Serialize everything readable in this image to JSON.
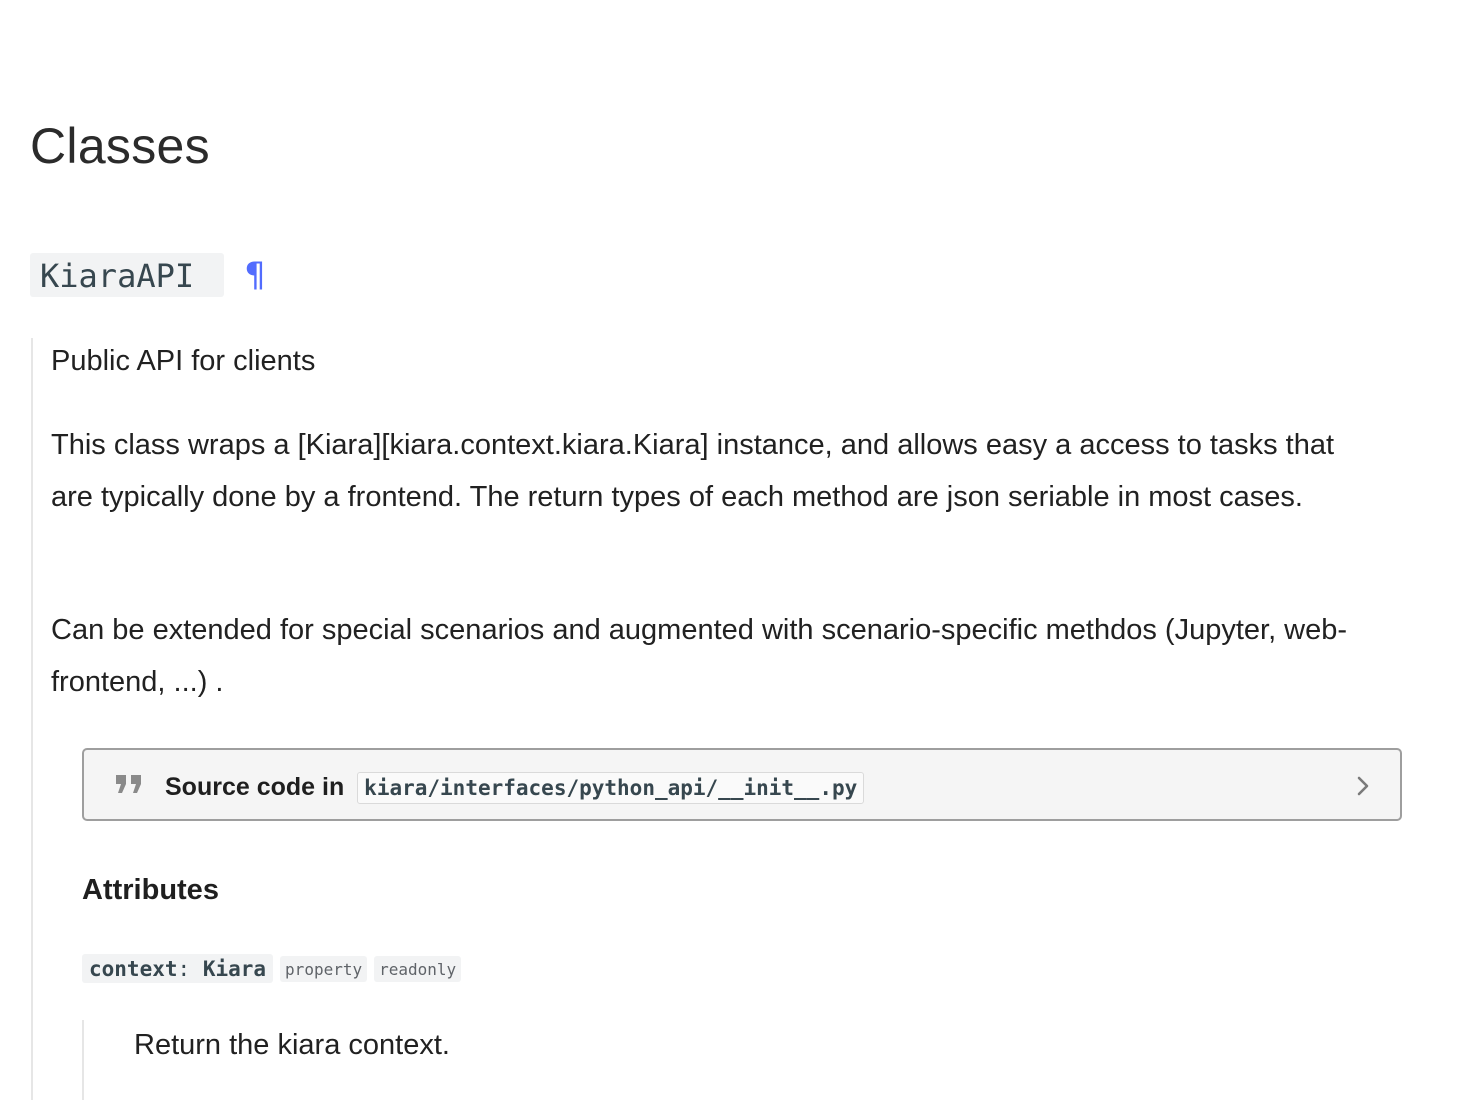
{
  "section": {
    "heading": "Classes"
  },
  "class": {
    "name": "KiaraAPI",
    "permalink": "¶",
    "summary": "Public API for clients",
    "description": "This class wraps a [Kiara][kiara.context.kiara.Kiara] instance, and allows easy a access to tasks that are typically done by a frontend. The return types of each method are json seriable in most cases.",
    "extension_note": "Can be extended for special scenarios and augmented with scenario-specific methdos (Jupyter, web-frontend, ...) .",
    "source": {
      "label": "Source code in",
      "path": "kiara/interfaces/python_api/__init__.py",
      "icon": "quote-icon",
      "expand_icon": "chevron-right-icon"
    },
    "attributes": {
      "heading": "Attributes",
      "items": [
        {
          "name": "context",
          "separator": ":",
          "type": "Kiara",
          "badges": [
            "property",
            "readonly"
          ],
          "doc": "Return the kiara context."
        }
      ]
    }
  },
  "colors": {
    "accent": "#526cfe",
    "code_background": "#f2f3f4",
    "source_border": "#9e9e9e",
    "text": "#212121"
  }
}
